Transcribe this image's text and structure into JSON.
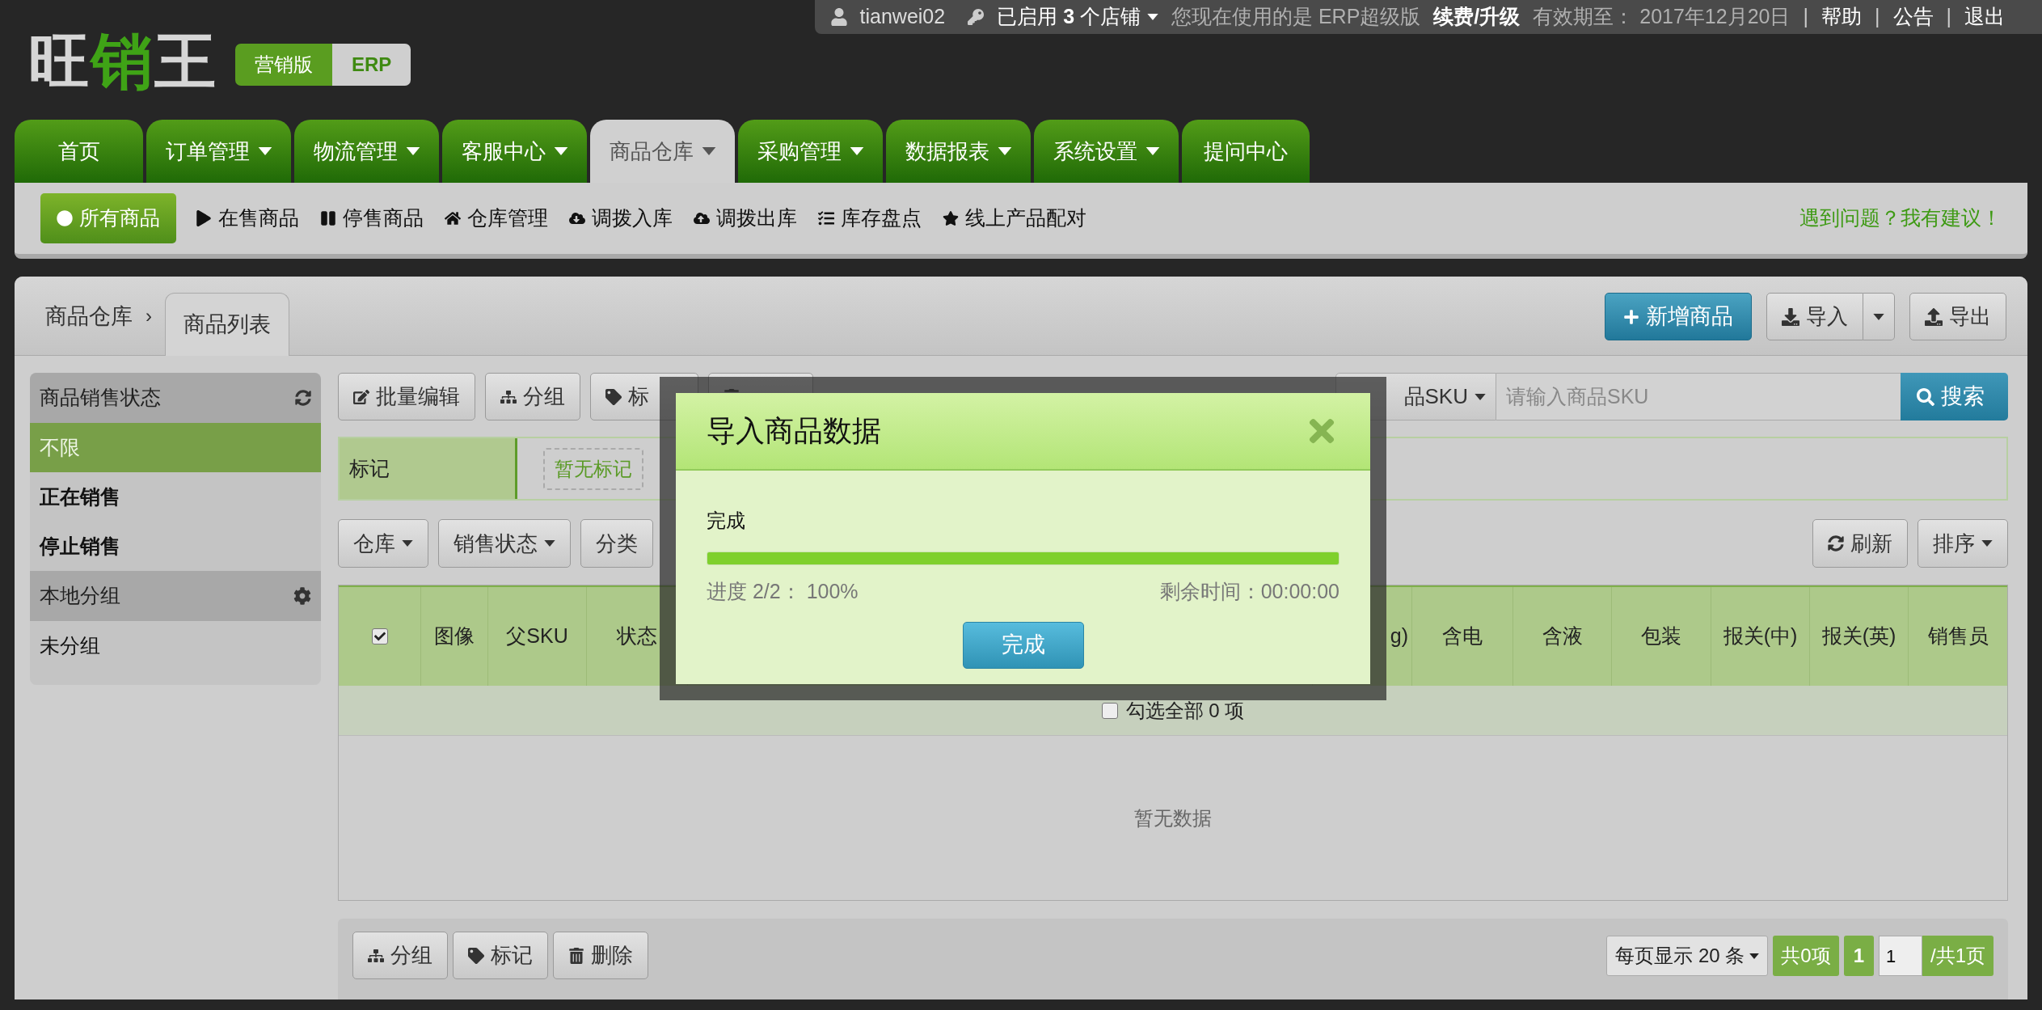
{
  "user_bar": {
    "username": "tianwei02",
    "stores": "已启用 **3** 个店铺",
    "notice": "您现在使用的是 ERP超级版",
    "upgrade": "续费/升级",
    "expiry": "有效期至： 2017年12月20日",
    "separator": "|",
    "links": [
      "帮助",
      "公告",
      "退出"
    ]
  },
  "logo": {
    "prefix": "旺",
    "highlight": "销",
    "suffix": "王"
  },
  "edition_badges": [
    {
      "label": "营销版",
      "selected": false
    },
    {
      "label": "ERP",
      "selected": true
    }
  ],
  "nav_tabs": [
    {
      "label": "首页",
      "dropdown": false,
      "selected": false
    },
    {
      "label": "订单管理",
      "dropdown": true,
      "selected": false
    },
    {
      "label": "物流管理",
      "dropdown": true,
      "selected": false
    },
    {
      "label": "客服中心",
      "dropdown": true,
      "selected": false
    },
    {
      "label": "商品仓库",
      "dropdown": true,
      "selected": true
    },
    {
      "label": "采购管理",
      "dropdown": true,
      "selected": false
    },
    {
      "label": "数据报表",
      "dropdown": true,
      "selected": false
    },
    {
      "label": "系统设置",
      "dropdown": true,
      "selected": false
    },
    {
      "label": "提问中心",
      "dropdown": false,
      "selected": false
    }
  ],
  "subnav": {
    "items": [
      {
        "label": "所有商品",
        "selected": true
      },
      {
        "label": "在售商品",
        "selected": false
      },
      {
        "label": "停售商品",
        "selected": false
      },
      {
        "label": "仓库管理",
        "selected": false
      },
      {
        "label": "调拨入库",
        "selected": false
      },
      {
        "label": "调拨出库",
        "selected": false
      },
      {
        "label": "库存盘点",
        "selected": false
      },
      {
        "label": "线上产品配对",
        "selected": false
      }
    ],
    "feedback_link": "遇到问题？我有建议！"
  },
  "breadcrumb": {
    "root": "商品仓库",
    "separator": "›",
    "current": "商品列表"
  },
  "header_buttons": {
    "add": "新增商品",
    "import": "导入",
    "export": "导出"
  },
  "sidebar": [
    {
      "title": "商品销售状态",
      "items": [
        {
          "label": "不限",
          "selected": true
        },
        {
          "label": "正在销售",
          "selected": false
        },
        {
          "label": "停止销售",
          "selected": false
        }
      ]
    },
    {
      "title": "本地分组",
      "items": [
        {
          "label": "未分组",
          "selected": false
        }
      ]
    }
  ],
  "toolbar": [
    "批量编辑",
    "分组",
    "标"
  ],
  "search": {
    "field_select": "品SKU",
    "placeholder": "请输入商品SKU",
    "button": "搜索"
  },
  "tag_filter": {
    "label": "标记",
    "empty": "暂无标记"
  },
  "filters": [
    {
      "label": "仓库",
      "dropdown": true
    },
    {
      "label": "销售状态",
      "dropdown": true
    },
    {
      "label": "分类",
      "dropdown": false
    }
  ],
  "refresh": "刷新",
  "sort": "排序",
  "table": {
    "header_checked": true,
    "columns": [
      "图像",
      "父SKU",
      "状态",
      "g)",
      "含电",
      "含液",
      "包装",
      "报关(中)",
      "报关(英)",
      "销售员"
    ],
    "select_all": {
      "checked": false,
      "label": "勾选全部 0 项"
    },
    "empty": "暂无数据"
  },
  "bottom_buttons": [
    "分组",
    "标记",
    "删除"
  ],
  "pagination": {
    "page_size": "每页显示 20 条",
    "total": "共0项",
    "pages": [
      {
        "label": "1",
        "selected": true
      }
    ],
    "page_input": "1",
    "page_count": "/共1页"
  },
  "dialog": {
    "title": "导入商品数据",
    "status": "完成",
    "progress": {
      "level": 1
    },
    "progress_text": "进度 2/2： 100%",
    "remaining": "剩余时间：00:00:00",
    "button": "完成"
  }
}
